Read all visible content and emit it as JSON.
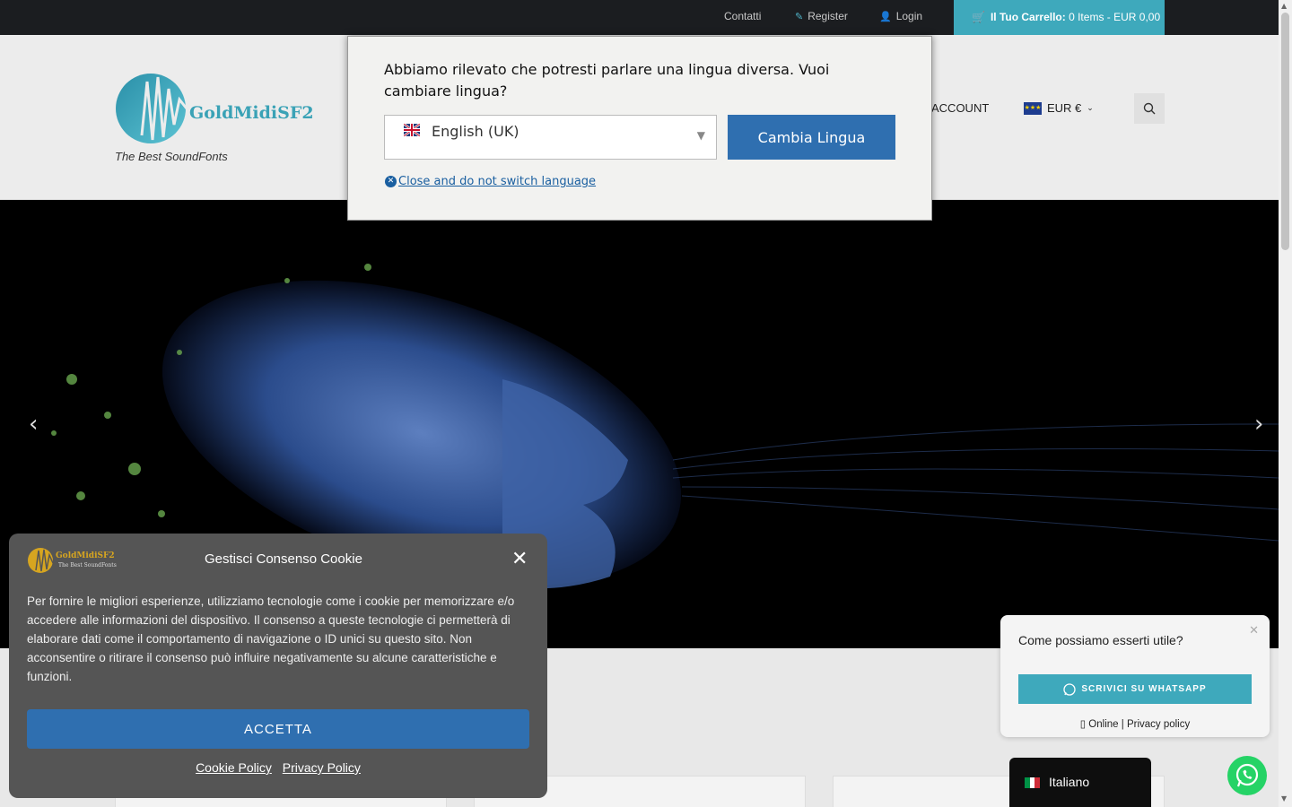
{
  "topbar": {
    "contact": "Contatti",
    "register": "Register",
    "login": "Login",
    "cart_label": "Il Tuo Carrello:",
    "cart_summary": "0 Items - EUR 0,00"
  },
  "header": {
    "logo_text": "GoldMidiSF2",
    "tagline": "The Best SoundFonts",
    "account": "ACCOUNT",
    "currency": "EUR €"
  },
  "language_modal": {
    "question": "Abbiamo rilevato che potresti parlare una lingua diversa. Vuoi cambiare lingua?",
    "selected_language": "English (UK)",
    "switch_button": "Cambia Lingua",
    "close_link": "Close and do not switch language"
  },
  "cookie_banner": {
    "logo_text": "GoldMidiSF2",
    "logo_tagline": "The Best SoundFonts",
    "title": "Gestisci Consenso Cookie",
    "body": "Per fornire le migliori esperienze, utilizziamo tecnologie come i cookie per memorizzare e/o accedere alle informazioni del dispositivo. Il consenso a queste tecnologie ci permetterà di elaborare dati come il comportamento di navigazione o ID unici su questo sito. Non acconsentire o ritirare il consenso può influire negativamente su alcune caratteristiche e funzioni.",
    "accept_button": "ACCETTA",
    "cookie_policy": "Cookie Policy",
    "privacy_policy": "Privacy Policy"
  },
  "whatsapp_popup": {
    "question": "Come possiamo esserti utile?",
    "button": "SCRIVICI SU WHATSAPP",
    "status": "Online",
    "privacy": "Privacy policy"
  },
  "language_switcher": {
    "current": "Italiano"
  },
  "colors": {
    "accent": "#3ea9bc",
    "primary_button": "#2f6fb0",
    "topbar": "#1b1d20"
  }
}
